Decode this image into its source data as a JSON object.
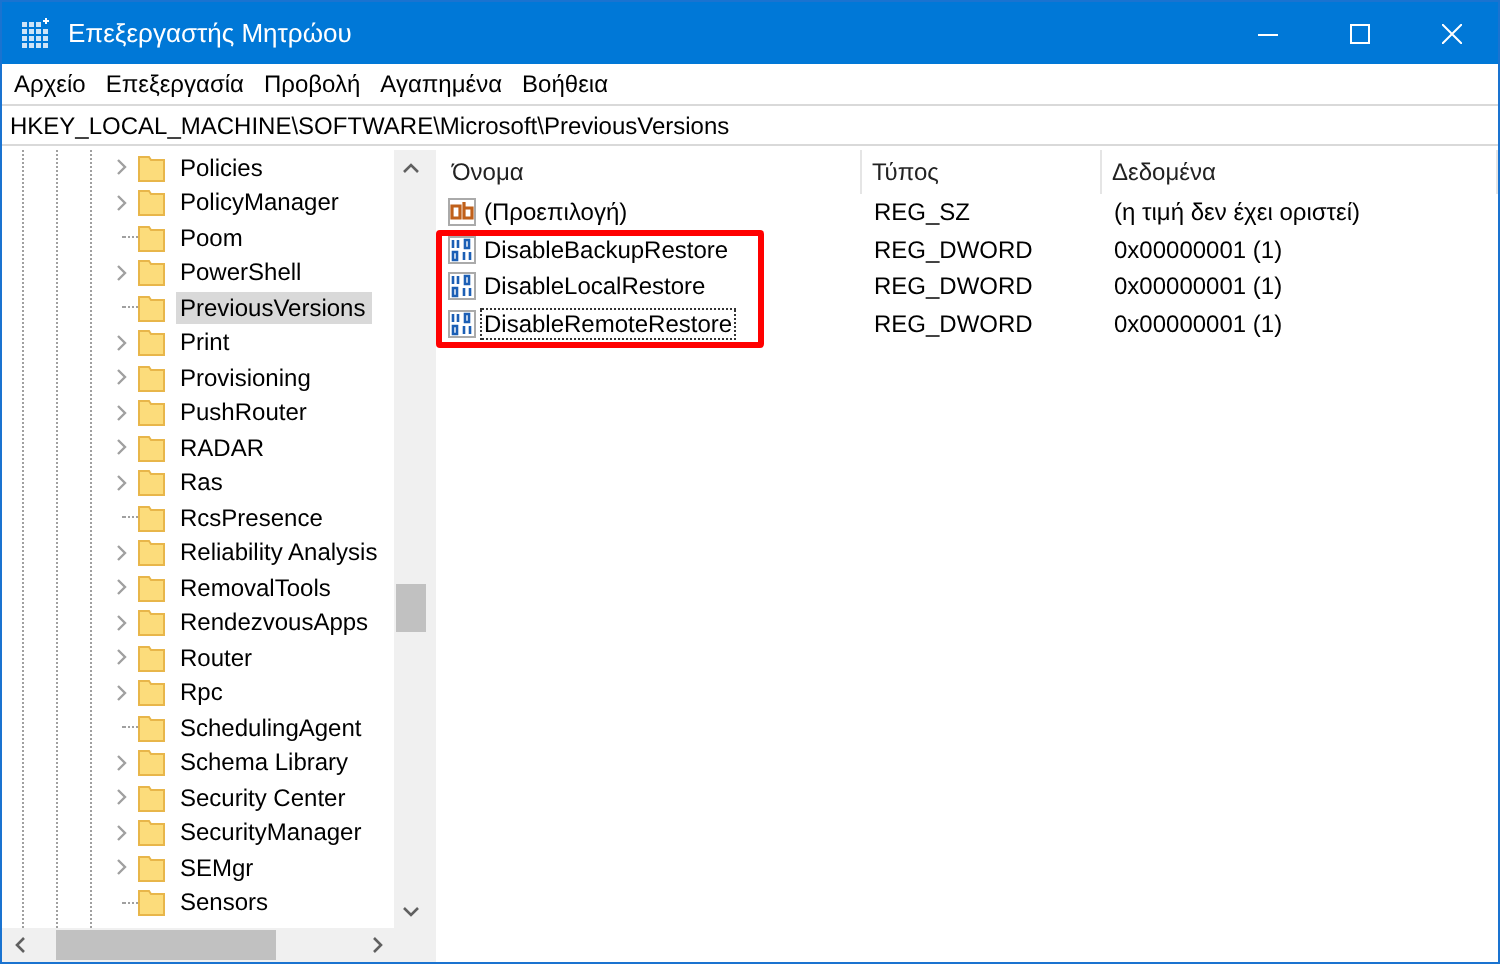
{
  "window": {
    "title": "Επεξεργαστής Μητρώου"
  },
  "menu": [
    "Αρχείο",
    "Επεξεργασία",
    "Προβολή",
    "Αγαπημένα",
    "Βοήθεια"
  ],
  "address": "HKEY_LOCAL_MACHINE\\SOFTWARE\\Microsoft\\PreviousVersions",
  "tree": [
    {
      "label": "Policies",
      "expandable": true,
      "selected": false
    },
    {
      "label": "PolicyManager",
      "expandable": true,
      "selected": false
    },
    {
      "label": "Poom",
      "expandable": false,
      "selected": false
    },
    {
      "label": "PowerShell",
      "expandable": true,
      "selected": false
    },
    {
      "label": "PreviousVersions",
      "expandable": false,
      "selected": true
    },
    {
      "label": "Print",
      "expandable": true,
      "selected": false
    },
    {
      "label": "Provisioning",
      "expandable": true,
      "selected": false
    },
    {
      "label": "PushRouter",
      "expandable": true,
      "selected": false
    },
    {
      "label": "RADAR",
      "expandable": true,
      "selected": false
    },
    {
      "label": "Ras",
      "expandable": true,
      "selected": false
    },
    {
      "label": "RcsPresence",
      "expandable": false,
      "selected": false
    },
    {
      "label": "Reliability Analysis",
      "expandable": true,
      "selected": false
    },
    {
      "label": "RemovalTools",
      "expandable": true,
      "selected": false
    },
    {
      "label": "RendezvousApps",
      "expandable": true,
      "selected": false
    },
    {
      "label": "Router",
      "expandable": true,
      "selected": false
    },
    {
      "label": "Rpc",
      "expandable": true,
      "selected": false
    },
    {
      "label": "SchedulingAgent",
      "expandable": false,
      "selected": false
    },
    {
      "label": "Schema Library",
      "expandable": true,
      "selected": false
    },
    {
      "label": "Security Center",
      "expandable": true,
      "selected": false
    },
    {
      "label": "SecurityManager",
      "expandable": true,
      "selected": false
    },
    {
      "label": "SEMgr",
      "expandable": true,
      "selected": false
    },
    {
      "label": "Sensors",
      "expandable": false,
      "selected": false
    }
  ],
  "columns": [
    "Όνομα",
    "Τύπος",
    "Δεδομένα"
  ],
  "values": [
    {
      "kind": "string",
      "name": "(Προεπιλογή)",
      "type": "REG_SZ",
      "data": "(η τιμή δεν έχει οριστεί)",
      "focused": false,
      "highlighted": false
    },
    {
      "kind": "binary",
      "name": "DisableBackupRestore",
      "type": "REG_DWORD",
      "data": "0x00000001 (1)",
      "focused": false,
      "highlighted": true
    },
    {
      "kind": "binary",
      "name": "DisableLocalRestore",
      "type": "REG_DWORD",
      "data": "0x00000001 (1)",
      "focused": false,
      "highlighted": true
    },
    {
      "kind": "binary",
      "name": "DisableRemoteRestore",
      "type": "REG_DWORD",
      "data": "0x00000001 (1)",
      "focused": true,
      "highlighted": true
    }
  ]
}
